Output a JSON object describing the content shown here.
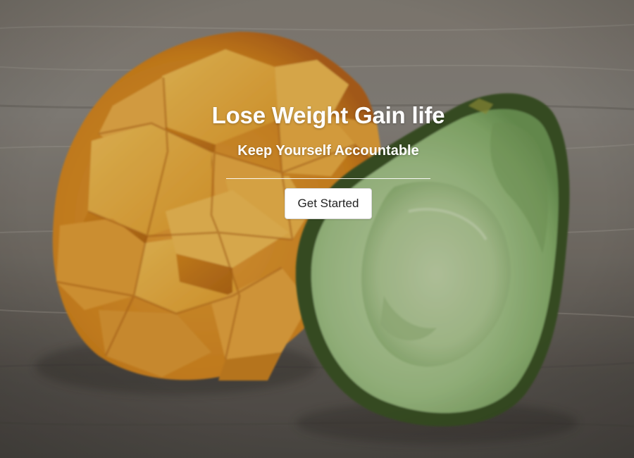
{
  "hero": {
    "headline": "Lose Weight Gain life",
    "subheadline": "Keep Yourself Accountable",
    "cta_label": "Get Started",
    "background_image": "mango-and-avocado-photo"
  },
  "colors": {
    "text": "#ffffff",
    "button_bg": "#ffffff",
    "button_text": "#222222",
    "wood": "#7b756d",
    "mango": "#f0a82c",
    "avocado_flesh": "#a9c98f",
    "avocado_skin": "#3f5a2a"
  }
}
